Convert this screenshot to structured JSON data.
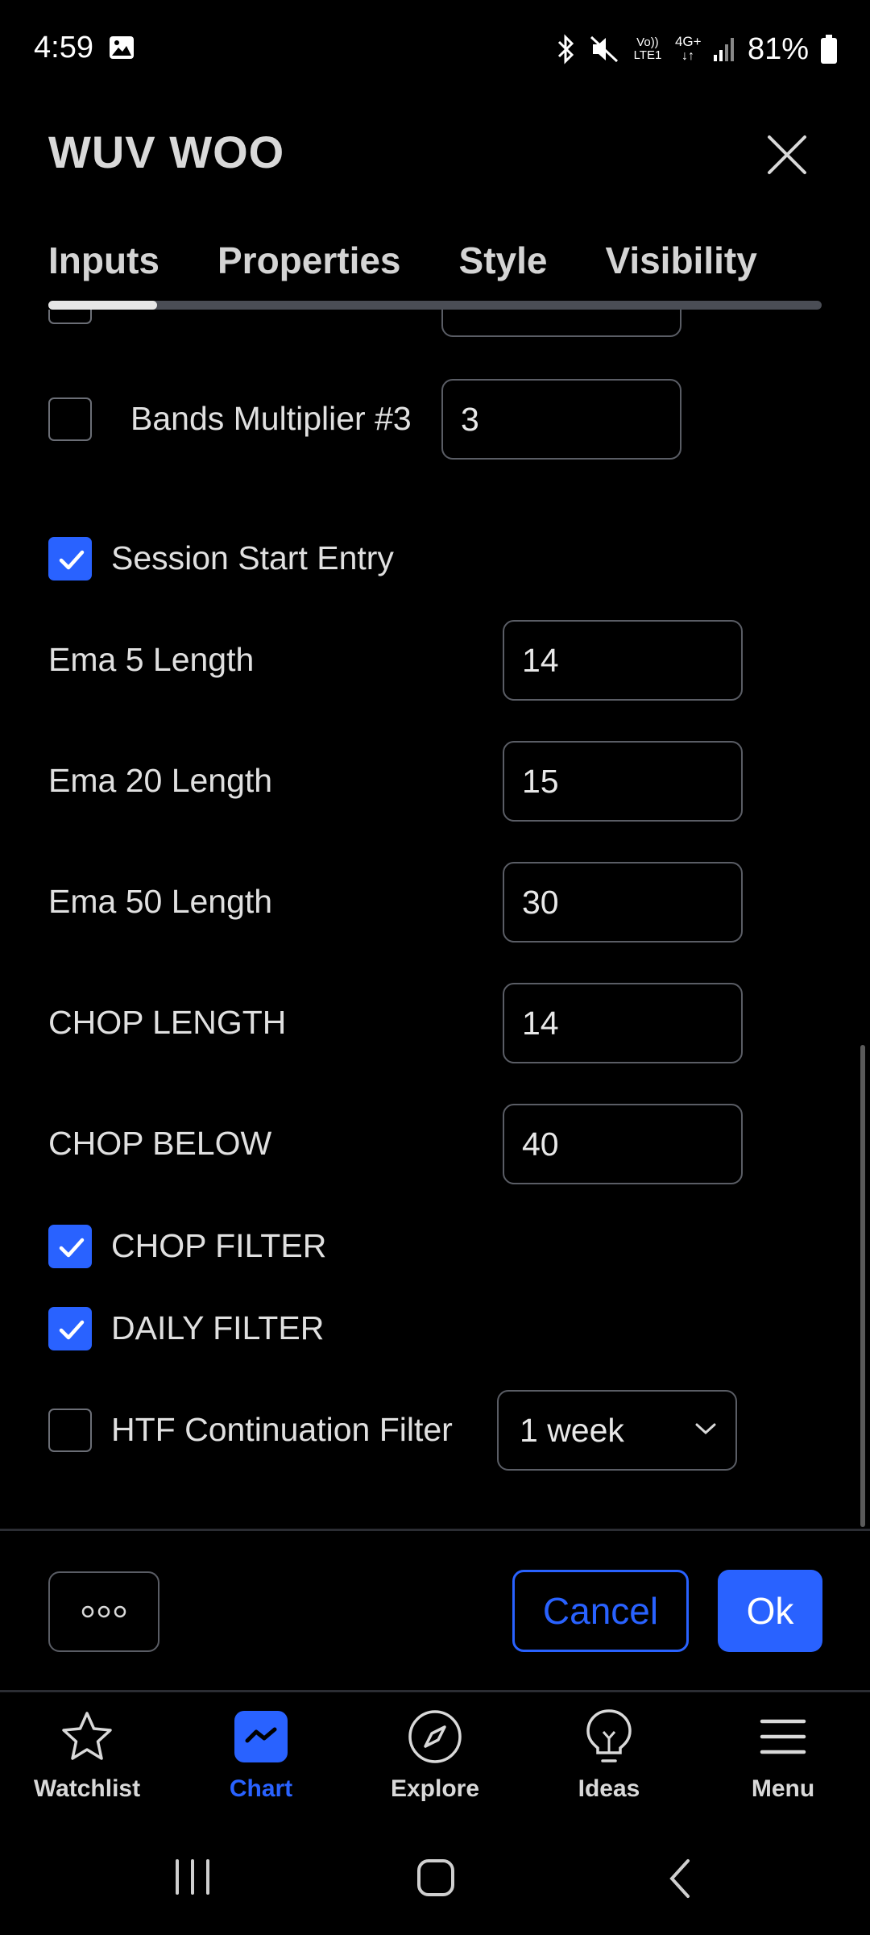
{
  "status_bar": {
    "time": "4:59",
    "battery": "81%",
    "network": "4G+",
    "volte": "Vo)) LTE1",
    "icons": [
      "image-icon",
      "bluetooth-icon",
      "mute-icon",
      "volte-icon",
      "data-icon",
      "signal-icon",
      "battery-icon"
    ]
  },
  "dialog": {
    "title": "WUV WOO",
    "tabs": [
      {
        "label": "Inputs",
        "active": true
      },
      {
        "label": "Properties",
        "active": false
      },
      {
        "label": "Style",
        "active": false
      },
      {
        "label": "Visibility",
        "active": false
      }
    ]
  },
  "inputs": {
    "bands_multiplier_3": {
      "label": "Bands Multiplier #3",
      "checked": false,
      "value": "3"
    },
    "session_start_entry": {
      "label": "Session Start Entry",
      "checked": true
    },
    "ema5": {
      "label": "Ema 5 Length",
      "value": "14"
    },
    "ema20": {
      "label": "Ema 20 Length",
      "value": "15"
    },
    "ema50": {
      "label": "Ema 50 Length",
      "value": "30"
    },
    "chop_length": {
      "label": "CHOP LENGTH",
      "value": "14"
    },
    "chop_below": {
      "label": "CHOP BELOW",
      "value": "40"
    },
    "chop_filter": {
      "label": "CHOP FILTER",
      "checked": true
    },
    "daily_filter": {
      "label": "DAILY FILTER",
      "checked": true
    },
    "htf_continuation_filter": {
      "label": "HTF Continuation Filter",
      "checked": false,
      "selected": "1 week"
    }
  },
  "footer": {
    "cancel_label": "Cancel",
    "ok_label": "Ok"
  },
  "bottom_nav": [
    {
      "label": "Watchlist",
      "icon": "star-icon",
      "active": false
    },
    {
      "label": "Chart",
      "icon": "chart-icon",
      "active": true
    },
    {
      "label": "Explore",
      "icon": "compass-icon",
      "active": false
    },
    {
      "label": "Ideas",
      "icon": "lightbulb-icon",
      "active": false
    },
    {
      "label": "Menu",
      "icon": "hamburger-icon",
      "active": false
    }
  ],
  "colors": {
    "accent": "#2962ff",
    "background": "#000000",
    "text": "#e0e0e0",
    "border": "#5a5d65"
  }
}
